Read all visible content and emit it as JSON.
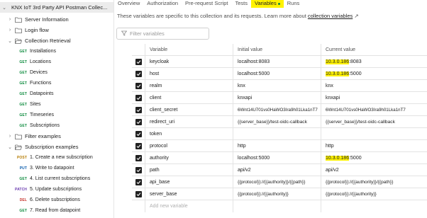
{
  "sidebar": {
    "collection": "KNX IoT 3rd Party API Postman Collec...",
    "server_information": "Server Information",
    "login_flow": "Login flow",
    "collection_retrieval": "Collection Retrieval",
    "retrieval_items": [
      {
        "method": "GET",
        "label": "Installations"
      },
      {
        "method": "GET",
        "label": "Locations"
      },
      {
        "method": "GET",
        "label": "Devices"
      },
      {
        "method": "GET",
        "label": "Functions"
      },
      {
        "method": "GET",
        "label": "Datapoints"
      },
      {
        "method": "GET",
        "label": "Sites"
      },
      {
        "method": "GET",
        "label": "Timeseries"
      },
      {
        "method": "GET",
        "label": "Subscriptions"
      }
    ],
    "filter_examples": "Filter examples",
    "subscription_examples": "Subscription examples",
    "subscription_items": [
      {
        "method": "POST",
        "label": "1. Create a new subscription"
      },
      {
        "method": "PUT",
        "label": "3. Write to datapoint"
      },
      {
        "method": "GET",
        "label": "4. List current subscriptions"
      },
      {
        "method": "PATCH",
        "label": "5. Update subscriptions"
      },
      {
        "method": "DEL",
        "label": "6. Delete subscriptions"
      },
      {
        "method": "GET",
        "label": "7. Read from datapoint"
      }
    ]
  },
  "tabs": {
    "overview": "Overview",
    "authorization": "Authorization",
    "prerequest": "Pre-request Script",
    "tests": "Tests",
    "variables": "Variables",
    "runs": "Runs"
  },
  "description": {
    "text": "These variables are specific to this collection and its requests. Learn more about ",
    "link": "collection variables",
    "arrow": "↗"
  },
  "filter": {
    "placeholder": "Filter variables"
  },
  "table": {
    "headers": {
      "variable": "Variable",
      "initial": "Initial value",
      "current": "Current value"
    },
    "rows": [
      {
        "variable": "keycloak",
        "initial": "localhost:8083",
        "current_hl": "10.3.0.186",
        "current_rest": ":8083"
      },
      {
        "variable": "host",
        "initial": "localhost:5000",
        "current_hl": "10.3.0.186",
        "current_rest": ":5000"
      },
      {
        "variable": "realm",
        "initial": "knx",
        "current_hl": "",
        "current_rest": "knx"
      },
      {
        "variable": "client",
        "initial": "knxapi",
        "current_hl": "",
        "current_rest": "knxapi"
      },
      {
        "variable": "client_secret",
        "initial": "6Wnt14U701vs0HaWO3Ira9h01Lka1nT7",
        "current_hl": "",
        "current_rest": "6Wnt14U701vs0HaWO3Ira9h01Lka1nT7"
      },
      {
        "variable": "redirect_uri",
        "initial": "{{server_base}}/test-oidc-callback",
        "current_hl": "",
        "current_rest": "{{server_base}}/test-oidc-callback"
      },
      {
        "variable": "token",
        "initial": "",
        "current_hl": "",
        "current_rest": ""
      },
      {
        "variable": "protocol",
        "initial": "http",
        "current_hl": "",
        "current_rest": "http"
      },
      {
        "variable": "authority",
        "initial": "localhost:5000",
        "current_hl": "10.3.0.186",
        "current_rest": ":5000"
      },
      {
        "variable": "path",
        "initial": "api/v2",
        "current_hl": "",
        "current_rest": "api/v2"
      },
      {
        "variable": "api_base",
        "initial": "{{protocol}}://{{authority}}/{{path}}",
        "current_hl": "",
        "current_rest": "{{protocol}}://{{authority}}/{{path}}"
      },
      {
        "variable": "server_base",
        "initial": "{{protocol}}://{{authority}}",
        "current_hl": "",
        "current_rest": "{{protocol}}://{{authority}}"
      }
    ],
    "add_placeholder": "Add new variable"
  },
  "colors": {
    "highlight": "#fff200",
    "get": "#0b8a3d",
    "post": "#b57b00",
    "put": "#0b5cad",
    "patch": "#6b3cb0",
    "delete": "#c8362e"
  }
}
